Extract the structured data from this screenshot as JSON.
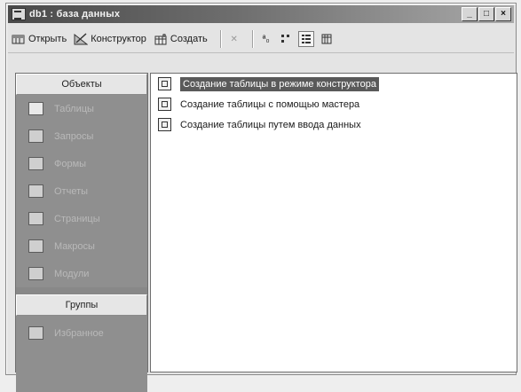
{
  "window": {
    "title": "db1 : база данных",
    "controls": [
      "_",
      "□",
      "×"
    ]
  },
  "toolbar": {
    "open_label": "Открыть",
    "design_label": "Конструктор",
    "create_label": "Создать",
    "delete_icon": "x-icon",
    "view_icons": [
      "large-icons-icon",
      "small-icons-icon",
      "list-icon",
      "details-icon"
    ],
    "large_icons_glyph": "ª₀"
  },
  "objects_panel": {
    "header": "Объекты",
    "items": [
      {
        "label": "Таблицы",
        "icon": "table-icon"
      },
      {
        "label": "Запросы",
        "icon": "query-icon"
      },
      {
        "label": "Формы",
        "icon": "form-icon"
      },
      {
        "label": "Отчеты",
        "icon": "report-icon"
      },
      {
        "label": "Страницы",
        "icon": "page-icon"
      },
      {
        "label": "Макросы",
        "icon": "macro-icon"
      },
      {
        "label": "Модули",
        "icon": "module-icon"
      }
    ],
    "groups_header": "Группы",
    "groups": [
      {
        "label": "Избранное",
        "icon": "favorites-icon"
      }
    ]
  },
  "list": {
    "rows": [
      {
        "label": "Создание таблицы в режиме конструктора",
        "selected": true
      },
      {
        "label": "Создание таблицы с помощью мастера",
        "selected": false
      },
      {
        "label": "Создание таблицы путем ввода данных",
        "selected": false
      }
    ]
  },
  "colors": {
    "selection": "#5a5a5a",
    "panel": "#8f8f8f",
    "titlebar_start": "#4a4a4a"
  }
}
